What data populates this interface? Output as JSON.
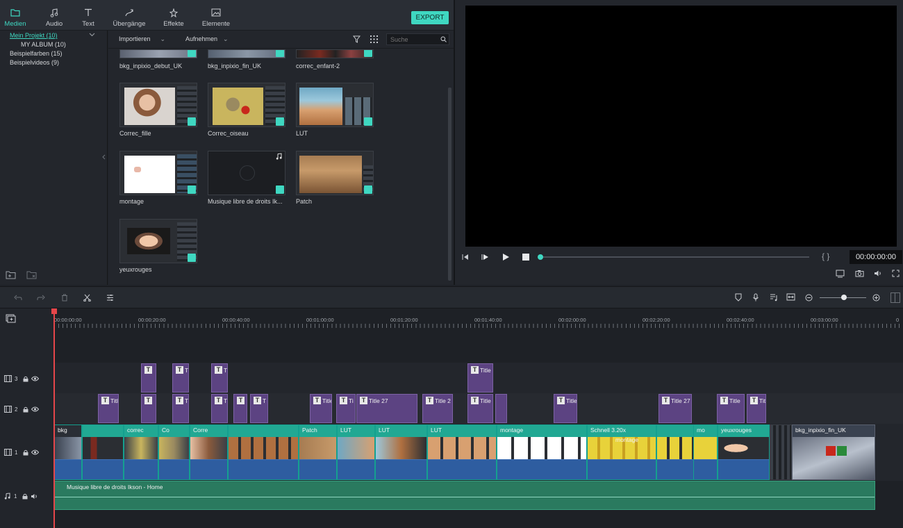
{
  "toolbar": {
    "tabs": [
      {
        "label": "Medien",
        "icon": "folder-icon"
      },
      {
        "label": "Audio",
        "icon": "music-note-icon"
      },
      {
        "label": "Text",
        "icon": "text-icon"
      },
      {
        "label": "Übergänge",
        "icon": "transition-icon"
      },
      {
        "label": "Effekte",
        "icon": "effects-icon"
      },
      {
        "label": "Elemente",
        "icon": "image-icon"
      }
    ],
    "export_label": "EXPORT"
  },
  "sidebar": {
    "items": [
      {
        "label": "Mein Projekt (10)"
      },
      {
        "label": "MY ALBUM (10)"
      },
      {
        "label": "Beispielfarben (15)"
      },
      {
        "label": "Beispielvideos (9)"
      }
    ]
  },
  "media": {
    "import_label": "Importieren",
    "record_label": "Aufnehmen",
    "search_placeholder": "Suche",
    "items": [
      {
        "label": "bkg_inpixio_debut_UK"
      },
      {
        "label": "bkg_inpixio_fin_UK"
      },
      {
        "label": "correc_enfant-2"
      },
      {
        "label": "Correc_fille"
      },
      {
        "label": "Correc_oiseau"
      },
      {
        "label": "LUT"
      },
      {
        "label": "montage"
      },
      {
        "label": "Musique libre de droits Ik..."
      },
      {
        "label": "Patch"
      },
      {
        "label": "yeuxrouges"
      }
    ]
  },
  "preview": {
    "timecode": "00:00:00:00",
    "progress": 0
  },
  "timeline": {
    "ruler": [
      "00:00:00:00",
      "00:00:20:00",
      "00:00:40:00",
      "00:01:00:00",
      "00:01:20:00",
      "00:01:40:00",
      "00:02:00:00",
      "00:02:20:00",
      "00:02:40:00",
      "00:03:00:00",
      "0"
    ],
    "tracks": [
      {
        "label": "3"
      },
      {
        "label": "2"
      },
      {
        "label": "1"
      },
      {
        "label": "1"
      }
    ],
    "track3_clips": [
      "T",
      "T",
      "T",
      "Title"
    ],
    "track2_clips": [
      "Titl",
      "T",
      "T",
      "T",
      "",
      "T",
      "Title",
      "Ti",
      "Title 27",
      "Title 2",
      "Title",
      "",
      "Title",
      "Title 27",
      "Title",
      "Tit"
    ],
    "video_clips": [
      "bkg",
      "correc",
      "Co",
      "Corre",
      "Patch",
      "LUT",
      "LUT",
      "LUT",
      "montage",
      "Schnell 3.20x",
      "mo",
      "yeuxrouges",
      "bkg_inpixio_fin_UK"
    ],
    "video_sub_labels": [
      "montage"
    ],
    "audio_clip": "Musique libre de droits Ikson - Home",
    "zoom_level": 0.55
  }
}
